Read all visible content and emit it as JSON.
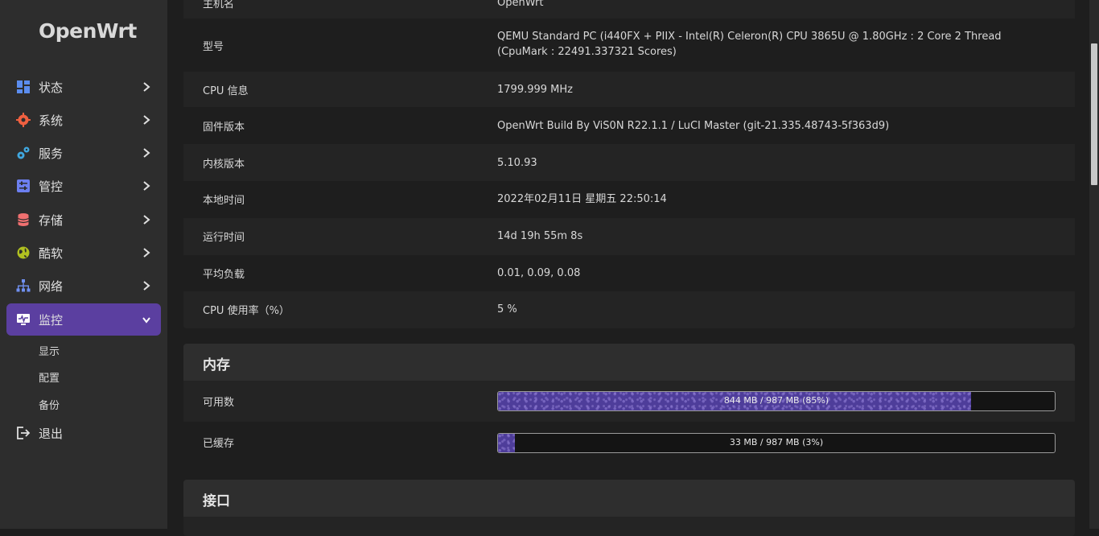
{
  "brand": {
    "logo": "OpenWrt"
  },
  "sidebar": {
    "items": [
      {
        "label": "状态",
        "icon": "dashboard-icon",
        "color": "#5b8def"
      },
      {
        "label": "系统",
        "icon": "gear-icon",
        "color": "#f06040"
      },
      {
        "label": "服务",
        "icon": "cogs-icon",
        "color": "#40a8e0"
      },
      {
        "label": "管控",
        "icon": "sliders-icon",
        "color": "#6c7ff0"
      },
      {
        "label": "存储",
        "icon": "database-icon",
        "color": "#f07070"
      },
      {
        "label": "酷软",
        "icon": "globe-icon",
        "color": "#b0c020"
      },
      {
        "label": "网络",
        "icon": "network-icon",
        "color": "#7090f0"
      },
      {
        "label": "监控",
        "icon": "monitor-icon",
        "color": "#ffffff"
      }
    ],
    "sub_items": [
      "显示",
      "配置",
      "备份"
    ],
    "logout": {
      "label": "退出",
      "icon": "logout-icon"
    }
  },
  "system_info": {
    "rows": [
      {
        "key": "主机名",
        "value": "OpenWrt"
      },
      {
        "key": "型号",
        "value": "QEMU Standard PC (i440FX + PIIX - Intel(R) Celeron(R) CPU 3865U @ 1.80GHz : 2 Core 2 Thread (CpuMark : 22491.337321 Scores)"
      },
      {
        "key": "CPU 信息",
        "value": "1799.999 MHz"
      },
      {
        "key": "固件版本",
        "value": "OpenWrt Build By ViS0N R22.1.1 / LuCI Master (git-21.335.48743-5f363d9)"
      },
      {
        "key": "内核版本",
        "value": "5.10.93"
      },
      {
        "key": "本地时间",
        "value": "2022年02月11日 星期五 22:50:14"
      },
      {
        "key": "运行时间",
        "value": "14d 19h 55m 8s"
      },
      {
        "key": "平均负载",
        "value": "0.01, 0.09, 0.08"
      },
      {
        "key": "CPU 使用率（%）",
        "value": "5 %"
      }
    ]
  },
  "memory": {
    "title": "内存",
    "rows": [
      {
        "key": "可用数",
        "bar_text": "844 MB / 987 MB (85%)",
        "fraction": 0.85
      },
      {
        "key": "已缓存",
        "bar_text": "33 MB / 987 MB (3%)",
        "fraction": 0.03
      }
    ]
  },
  "interfaces": {
    "title": "接口"
  }
}
